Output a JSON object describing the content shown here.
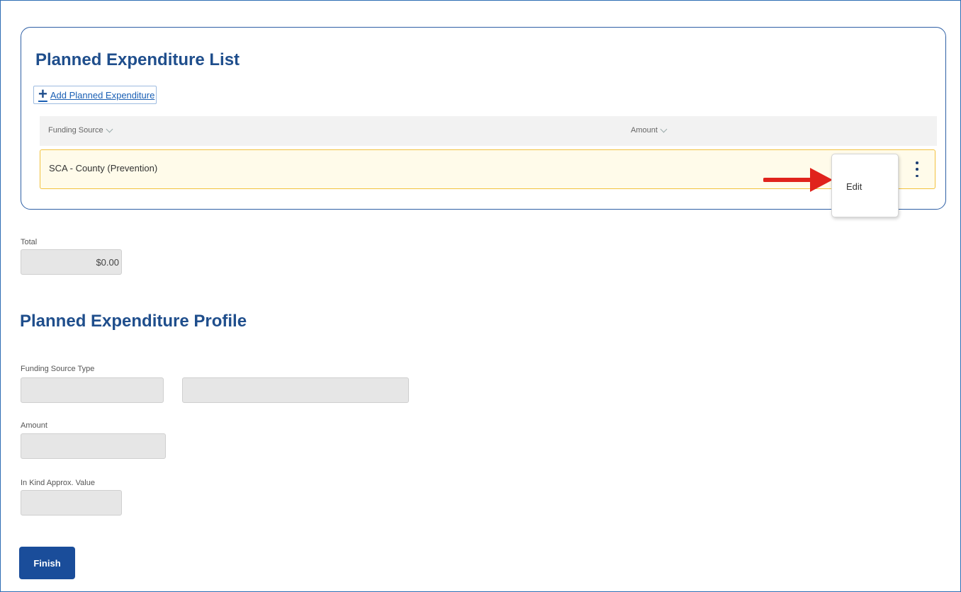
{
  "planned_expenditure_list": {
    "title": "Planned Expenditure List",
    "add_link_label": "Add Planned Expenditure",
    "columns": [
      "Funding Source",
      "Amount"
    ],
    "rows": [
      {
        "funding_source": "SCA - County (Prevention)",
        "amount": ""
      }
    ],
    "row_menu": {
      "items": [
        "Edit"
      ]
    }
  },
  "total": {
    "label": "Total",
    "value": "$0.00"
  },
  "profile": {
    "title": "Planned Expenditure Profile",
    "funding_source_type_label": "Funding Source Type",
    "amount_label": "Amount",
    "in_kind_label": "In Kind Approx. Value"
  },
  "actions": {
    "finish_label": "Finish"
  },
  "colors": {
    "heading": "#1f4e8c",
    "primary_button": "#1a4d9a",
    "row_highlight_border": "#f2c23f",
    "annotation_arrow": "#e0231c"
  }
}
